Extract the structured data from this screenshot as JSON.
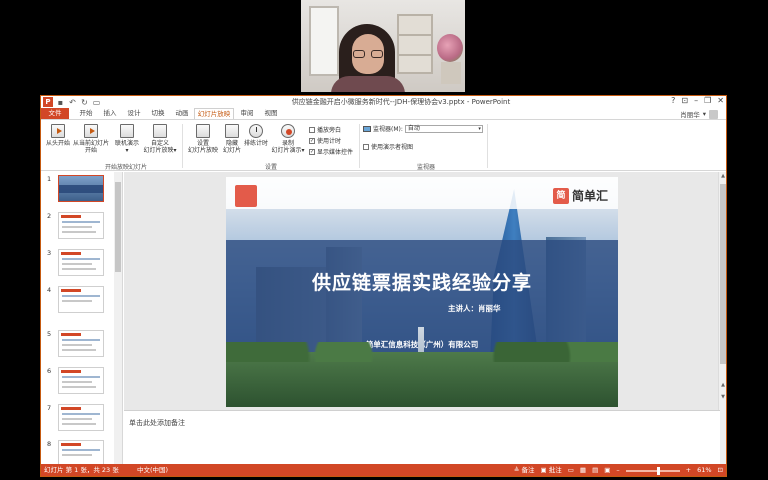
{
  "window": {
    "title": "供应链金融开启小微服务新时代--JDH-保理协会v3.pptx - PowerPoint",
    "controls": [
      "?",
      "⊡",
      "–",
      "❐",
      "✕"
    ],
    "app_icon": "P",
    "qat": [
      "save-icon",
      "undo-icon",
      "redo-icon",
      "slideshow-icon"
    ]
  },
  "tabs": [
    {
      "label": "文件"
    },
    {
      "label": "开始"
    },
    {
      "label": "插入"
    },
    {
      "label": "设计"
    },
    {
      "label": "切换"
    },
    {
      "label": "动画"
    },
    {
      "label": "幻灯片放映"
    },
    {
      "label": "审阅"
    },
    {
      "label": "视图"
    }
  ],
  "active_tab": "幻灯片放映",
  "user": {
    "name": "肖丽华"
  },
  "ribbon": {
    "buttons": {
      "from_start": "从头开始",
      "from_current_1": "从当前幻灯片",
      "from_current_2": "开始",
      "online_1": "联机演示",
      "online_2": "▾",
      "custom_1": "自定义",
      "custom_2": "幻灯片放映▾",
      "setup_1": "设置",
      "setup_2": "幻灯片放映",
      "hide_1": "隐藏",
      "hide_2": "幻灯片",
      "rehearse": "排练计时",
      "record_1": "录制",
      "record_2": "幻灯片演示▾"
    },
    "checkboxes": [
      {
        "label": "播放旁白",
        "checked": false
      },
      {
        "label": "使用计时",
        "checked": true
      },
      {
        "label": "显示媒体控件",
        "checked": true
      }
    ],
    "monitor": {
      "label": "监视器(M):",
      "value": "自动"
    },
    "presenter_view": {
      "label": "使用演示者视图",
      "checked": false
    },
    "groups": {
      "start": "开始放映幻灯片",
      "setup": "设置",
      "monitors": "监视器"
    }
  },
  "thumbnails": [
    "1",
    "2",
    "3",
    "4",
    "5",
    "6",
    "7",
    "8"
  ],
  "slide": {
    "title": "供应链票据实践经验分享",
    "speaker": "主讲人：肖丽华",
    "company": "简单汇信息科技（广州）有限公司",
    "logo_mark": "简",
    "logo_text": "简单汇"
  },
  "notes": {
    "placeholder": "单击此处添加备注"
  },
  "status": {
    "slide_info": "幻灯片 第 1 张，共 23 张",
    "language": "中文(中国)",
    "notes_btn": "≜ 备注",
    "comments_btn": "▣ 批注",
    "zoom": "61%",
    "zoom_level": 0.61
  },
  "colors": {
    "accent": "#d24726",
    "slide_band": "#2c4c80",
    "logo_red": "#e35b4a"
  }
}
